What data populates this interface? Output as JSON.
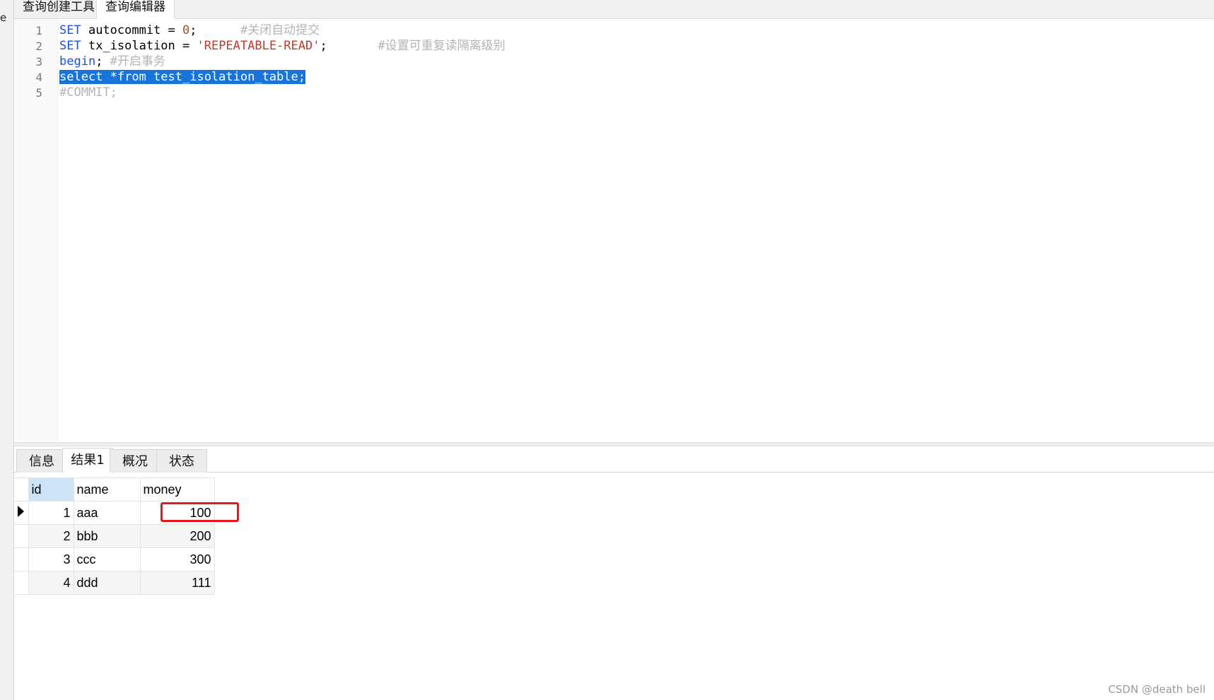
{
  "left_panel": {
    "glyph": "e"
  },
  "top_tabs": [
    {
      "label": "查询创建工具",
      "active": false
    },
    {
      "label": "查询编辑器",
      "active": true
    }
  ],
  "editor": {
    "lines": [
      {
        "number": "1",
        "tokens": [
          {
            "type": "kw",
            "text": "SET"
          },
          {
            "type": "id",
            "text": " autocommit = "
          },
          {
            "type": "num",
            "text": "0"
          },
          {
            "type": "id",
            "text": ";      "
          },
          {
            "type": "cmt",
            "text": "#关闭自动提交"
          }
        ]
      },
      {
        "number": "2",
        "tokens": [
          {
            "type": "kw",
            "text": "SET"
          },
          {
            "type": "id",
            "text": " tx_isolation = "
          },
          {
            "type": "str",
            "text": "'REPEATABLE-READ'"
          },
          {
            "type": "id",
            "text": ";       "
          },
          {
            "type": "cmt",
            "text": "#设置可重复读隔离级别"
          }
        ]
      },
      {
        "number": "3",
        "tokens": [
          {
            "type": "kw",
            "text": "begin"
          },
          {
            "type": "id",
            "text": "; "
          },
          {
            "type": "cmt",
            "text": "#开启事务"
          }
        ]
      },
      {
        "number": "4",
        "tokens": [
          {
            "type": "sel",
            "text": "select *from test_isolation_table;"
          }
        ]
      },
      {
        "number": "5",
        "tokens": [
          {
            "type": "cmt",
            "text": "#COMMIT;"
          }
        ]
      }
    ]
  },
  "result_tabs": [
    {
      "label": "信息",
      "active": false
    },
    {
      "label": "结果1",
      "active": true
    },
    {
      "label": "概况",
      "active": false
    },
    {
      "label": "状态",
      "active": false
    }
  ],
  "grid": {
    "columns": [
      "id",
      "name",
      "money"
    ],
    "rows": [
      {
        "id": "1",
        "name": "aaa",
        "money": "100",
        "current": true
      },
      {
        "id": "2",
        "name": "bbb",
        "money": "200",
        "current": false
      },
      {
        "id": "3",
        "name": "ccc",
        "money": "300",
        "current": false
      },
      {
        "id": "4",
        "name": "ddd",
        "money": "111",
        "current": false
      }
    ]
  },
  "watermark": "CSDN @death bell",
  "colors": {
    "selection": "#1874d8",
    "highlight_box": "#e4181c",
    "keyword": "#1f4fe0",
    "string": "#c0392b",
    "comment": "#b4b4b4"
  }
}
